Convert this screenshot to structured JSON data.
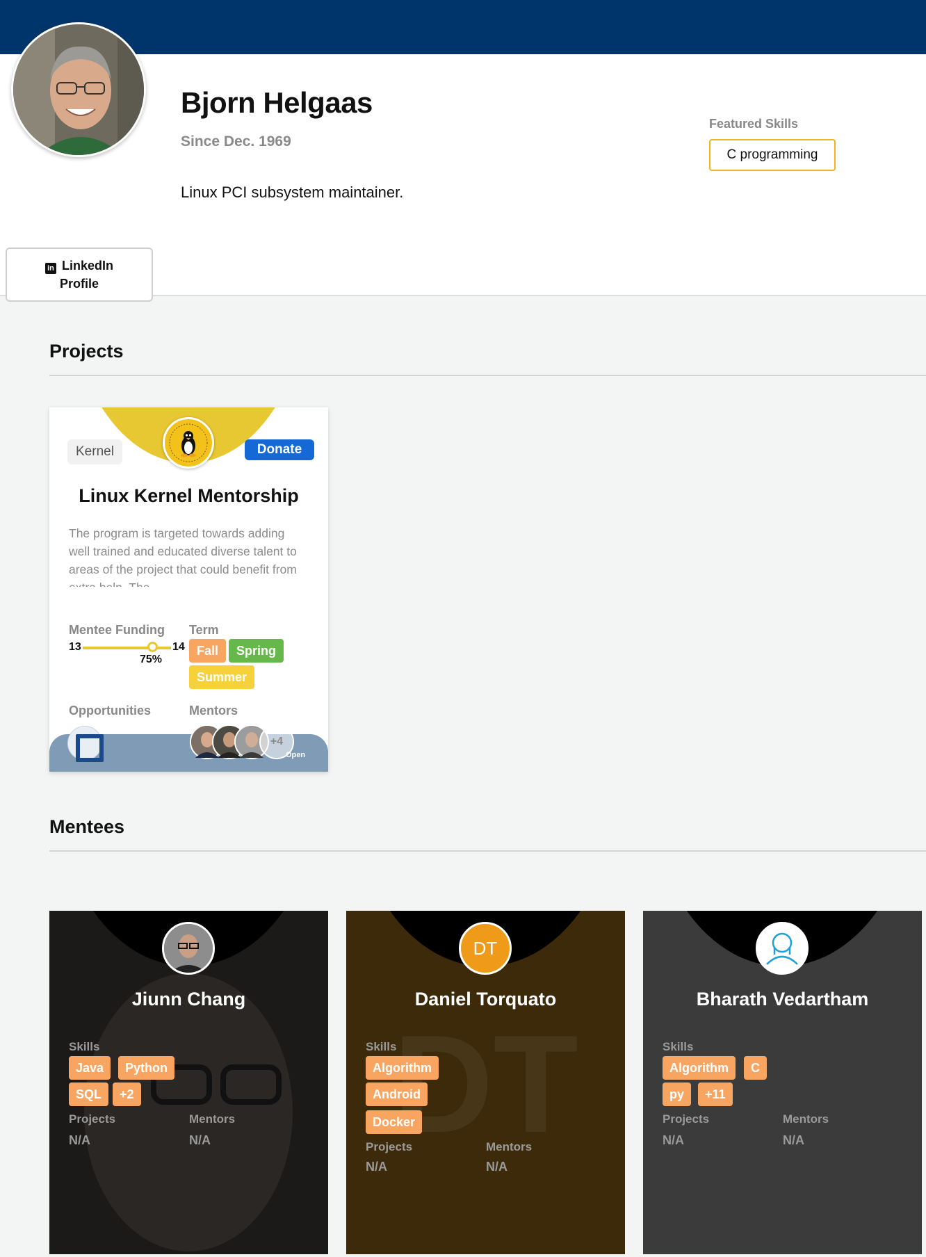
{
  "profile": {
    "name": "Bjorn Helgaas",
    "since": "Since Dec. 1969",
    "bio": "Linux PCI subsystem maintainer.",
    "linkedin_line1": "LinkedIn",
    "linkedin_line2": "Profile",
    "featured_skills_label": "Featured Skills",
    "featured_skills": [
      "C programming"
    ]
  },
  "projects_section": {
    "title": "Projects",
    "card": {
      "tag": "Kernel",
      "donate_label": "Donate",
      "title": "Linux Kernel Mentorship",
      "description": "The program is targeted towards adding well trained and educated diverse talent to areas of the project that could benefit from extra help. The",
      "funding_label": "Mentee Funding",
      "funding_start": "13",
      "funding_end": "14",
      "funding_percent_label": "75%",
      "funding_percent": 75,
      "term_label": "Term",
      "terms": [
        "Fall",
        "Spring",
        "Summer"
      ],
      "term_colors": [
        "#f7a561",
        "#66b84a",
        "#f6d13a"
      ],
      "opportunities_label": "Opportunities",
      "mentors_label": "Mentors",
      "mentors_more": "+4",
      "status": "Open",
      "accent_color": "#e8c832"
    }
  },
  "mentees_section": {
    "title": "Mentees",
    "projects_label": "Projects",
    "mentors_label": "Mentors",
    "skills_label": "Skills",
    "cards": [
      {
        "name": "Jiunn Chang",
        "skills": [
          "Java",
          "Python",
          "SQL",
          "+2"
        ],
        "projects": "N/A",
        "mentors": "N/A",
        "bg": "#1b1a19"
      },
      {
        "name": "Daniel Torquato",
        "initials": "DT",
        "skills": [
          "Algorithm",
          "Android",
          "Docker"
        ],
        "projects": "N/A",
        "mentors": "N/A",
        "bg": "#3d2a0a"
      },
      {
        "name": "Bharath Vedartham",
        "skills": [
          "Algorithm",
          "C",
          "py",
          "+11"
        ],
        "projects": "N/A",
        "mentors": "N/A",
        "bg": "#3b3b3b"
      }
    ]
  },
  "colors": {
    "header": "#00356b",
    "skill_chip": "#f7a561",
    "donate": "#1469d6",
    "featured_border": "#f3b41b"
  }
}
